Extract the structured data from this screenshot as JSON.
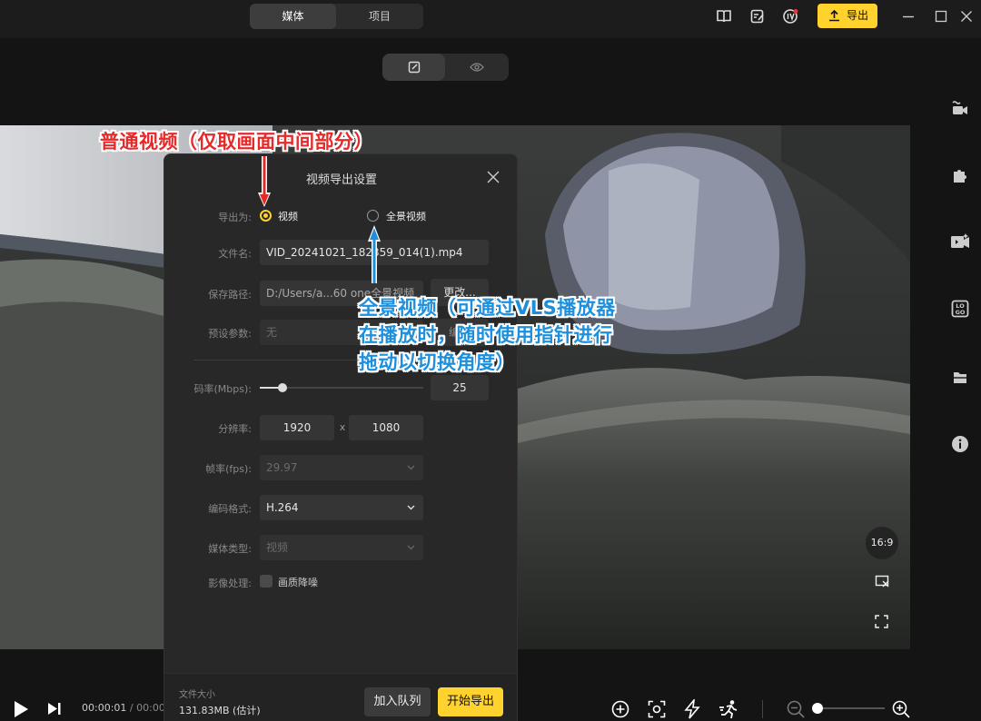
{
  "topbar": {
    "tabs": [
      {
        "label": "媒体"
      },
      {
        "label": "项目"
      }
    ],
    "export_label": "导出"
  },
  "preview_toggle": {
    "active": "edit"
  },
  "viewer": {
    "ratio_label": "16:9"
  },
  "dialog": {
    "title": "视频导出设置",
    "export_as_label": "导出为:",
    "option_video": "视频",
    "option_panorama": "全景视频",
    "filename_label": "文件名:",
    "filename_value": "VID_20241021_182359_014(1).mp4",
    "path_label": "保存路径:",
    "path_value": "D:/Users/a...60 one全景视频",
    "change_label": "更改...",
    "preset_label": "预设参数:",
    "preset_value": "无",
    "preset_edit_label": "编辑",
    "bitrate_label": "码率(Mbps):",
    "bitrate_value": "25",
    "bitrate_fraction": 0.14,
    "resolution_label": "分辨率:",
    "res_width": "1920",
    "res_sep": "x",
    "res_height": "1080",
    "fps_label": "帧率(fps):",
    "fps_value": "29.97",
    "codec_label": "编码格式:",
    "codec_value": "H.264",
    "media_type_label": "媒体类型:",
    "media_type_value": "视频",
    "image_proc_label": "影像处理:",
    "denoise_label": "画质降噪",
    "size_label": "文件大小",
    "size_value": "131.83MB (估计)",
    "queue_label": "加入队列",
    "start_label": "开始导出"
  },
  "bottombar": {
    "time_current": "00:00:01",
    "time_sep": "/",
    "time_total": "00:00"
  },
  "annotations": {
    "red_text": "普通视频（仅取画面中间部分）",
    "blue_line1": "全景视频（可通过VLS播放器",
    "blue_line2": "在播放时，随时使用指针进行",
    "blue_line3": "拖动以切换角度）"
  },
  "colors": {
    "accent": "#ffd22e",
    "red": "#e62a2a",
    "blue": "#1e8fdc"
  }
}
